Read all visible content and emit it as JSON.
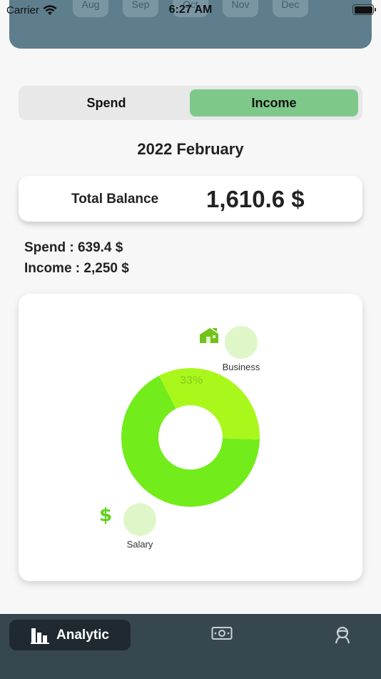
{
  "status_bar": {
    "carrier": "Carrier",
    "time": "6:27 AM"
  },
  "months": [
    "Aug",
    "Sep",
    "Oct",
    "Nov",
    "Dec"
  ],
  "segment": {
    "spend_label": "Spend",
    "income_label": "Income",
    "selected": "Income"
  },
  "period": "2022 February",
  "balance": {
    "label": "Total Balance",
    "value": "1,610.6 $"
  },
  "summary": {
    "spend": "Spend : 639.4 $",
    "income": "Income : 2,250 $"
  },
  "chart_data": {
    "type": "pie",
    "donut": true,
    "categories": [
      "Business",
      "Salary"
    ],
    "values": [
      33,
      67
    ],
    "labels": [
      "33%",
      ""
    ],
    "colors": [
      "#aaf71c",
      "#72ec1a"
    ]
  },
  "categories": [
    {
      "name": "Business",
      "icon": "house-icon"
    },
    {
      "name": "Salary",
      "icon": "dollar-icon"
    }
  ],
  "tabbar": {
    "items": [
      {
        "label": "Analytic",
        "icon": "bar-chart-icon",
        "active": true
      },
      {
        "label": "",
        "icon": "money-icon",
        "active": false
      },
      {
        "label": "",
        "icon": "profile-icon",
        "active": false
      }
    ]
  },
  "colors": {
    "accent_green": "#7ec98a",
    "panel": "#5f7e8d",
    "tabbar": "#37474f",
    "tab_active": "#1e2a30"
  }
}
